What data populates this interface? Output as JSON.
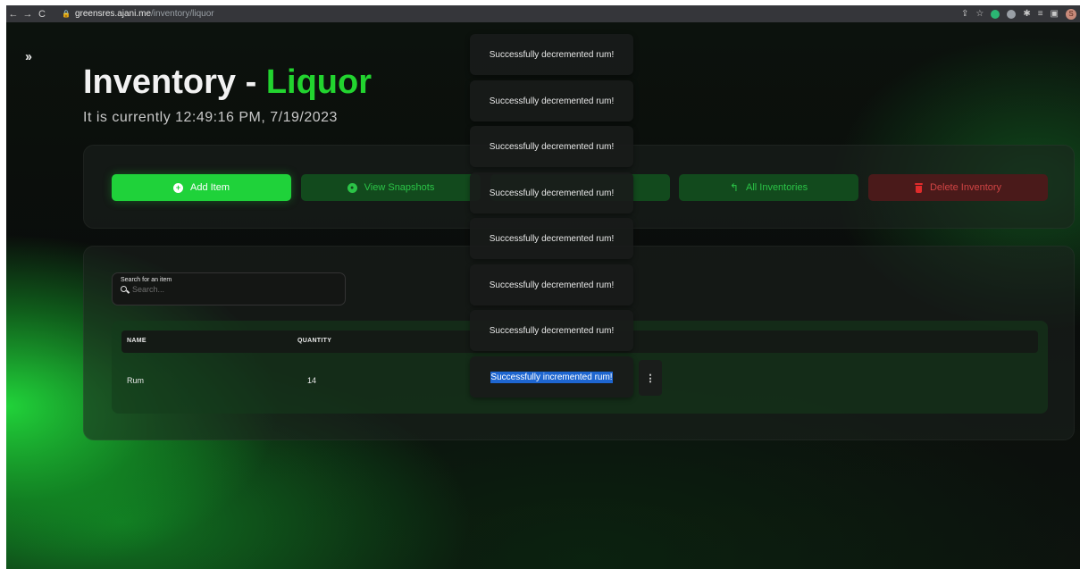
{
  "browser": {
    "url_host": "greensres.ajani.me",
    "url_path": "/inventory/liquor",
    "profile_initial": "S"
  },
  "page": {
    "title_prefix": "Inventory - ",
    "title_accent": "Liquor",
    "subtitle": "It is currently 12:49:16 PM, 7/19/2023",
    "accent_color": "#22d42f"
  },
  "actions": {
    "add_item": "Add Item",
    "view_snapshots": "View Snapshots",
    "third_button": "",
    "all_inventories": "All Inventories",
    "delete_inventory": "Delete Inventory"
  },
  "search": {
    "label": "Search for an item",
    "placeholder": "Search..."
  },
  "table": {
    "columns": [
      "NAME",
      "QUANTITY"
    ],
    "rows": [
      {
        "name": "Rum",
        "quantity": "14"
      }
    ]
  },
  "toasts": [
    "Successfully decremented rum!",
    "Successfully decremented rum!",
    "Successfully decremented rum!",
    "Successfully decremented rum!",
    "Successfully decremented rum!",
    "Successfully decremented rum!",
    "Successfully decremented rum!",
    "Successfully incremented rum!"
  ]
}
